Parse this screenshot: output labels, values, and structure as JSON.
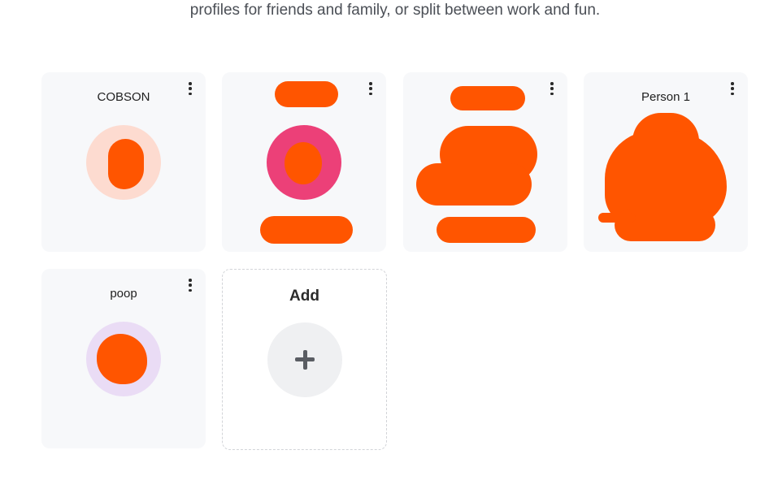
{
  "intro_text": "profiles for friends and family, or split between work and fun.",
  "profiles": [
    {
      "name": "COBSON",
      "avatar_color": "#fddbd0",
      "menu_icon": "more-vertical-icon"
    },
    {
      "name": "",
      "avatar_color": "#ec4078",
      "menu_icon": "more-vertical-icon"
    },
    {
      "name": "",
      "avatar_color": "",
      "menu_icon": "more-vertical-icon"
    },
    {
      "name": "Person 1",
      "avatar_color": "",
      "menu_icon": "more-vertical-icon"
    },
    {
      "name": "poop",
      "avatar_color": "#eadcf5",
      "menu_icon": "more-vertical-icon"
    }
  ],
  "add_card": {
    "label": "Add",
    "icon": "plus-icon"
  },
  "colors": {
    "redaction": "#ff5500",
    "card_bg": "#f7f8fa"
  }
}
